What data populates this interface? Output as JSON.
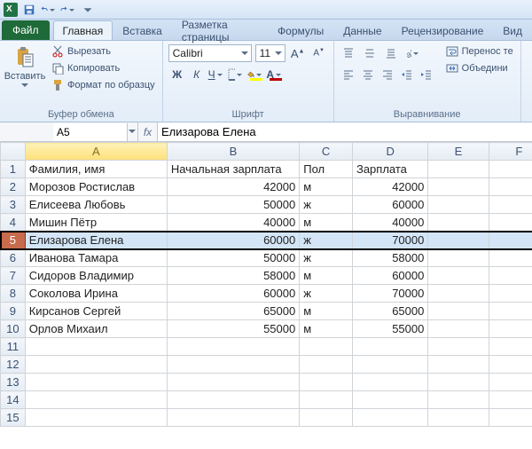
{
  "qat": {
    "save": "save-icon",
    "undo": "undo-icon",
    "redo": "redo-icon"
  },
  "tabs": {
    "file": "Файл",
    "items": [
      "Главная",
      "Вставка",
      "Разметка страницы",
      "Формулы",
      "Данные",
      "Рецензирование",
      "Вид"
    ],
    "active_index": 0
  },
  "ribbon": {
    "clipboard": {
      "paste": "Вставить",
      "cut": "Вырезать",
      "copy": "Копировать",
      "format_painter": "Формат по образцу",
      "group_label": "Буфер обмена"
    },
    "font": {
      "name": "Calibri",
      "size": "11",
      "bold": "Ж",
      "italic": "К",
      "underline": "Ч",
      "group_label": "Шрифт",
      "fill_color": "#ffff00",
      "font_color": "#c00000"
    },
    "alignment": {
      "wrap": "Перенос те",
      "merge": "Объедини",
      "group_label": "Выравнивание"
    }
  },
  "namebox": "A5",
  "fx_label": "fx",
  "formula": "Елизарова Елена",
  "columns": [
    "A",
    "B",
    "C",
    "D",
    "E",
    "F"
  ],
  "selected_row": 5,
  "selected_col": 0,
  "rows": [
    {
      "n": 1,
      "A": "Фамилия, имя",
      "B": "Начальная зарплата",
      "C": "Пол",
      "D": "Зарплата",
      "E": "",
      "F": ""
    },
    {
      "n": 2,
      "A": "Морозов Ростислав",
      "B": "42000",
      "C": "м",
      "D": "42000",
      "E": "",
      "F": ""
    },
    {
      "n": 3,
      "A": "Елисеева Любовь",
      "B": "50000",
      "C": "ж",
      "D": "60000",
      "E": "",
      "F": ""
    },
    {
      "n": 4,
      "A": "Мишин Пётр",
      "B": "40000",
      "C": "м",
      "D": "40000",
      "E": "",
      "F": ""
    },
    {
      "n": 5,
      "A": "Елизарова Елена",
      "B": "60000",
      "C": "ж",
      "D": "70000",
      "E": "",
      "F": ""
    },
    {
      "n": 6,
      "A": "Иванова Тамара",
      "B": "50000",
      "C": "ж",
      "D": "58000",
      "E": "",
      "F": ""
    },
    {
      "n": 7,
      "A": "Сидоров Владимир",
      "B": "58000",
      "C": "м",
      "D": "60000",
      "E": "",
      "F": ""
    },
    {
      "n": 8,
      "A": "Соколова Ирина",
      "B": "60000",
      "C": "ж",
      "D": "70000",
      "E": "",
      "F": ""
    },
    {
      "n": 9,
      "A": "Кирсанов Сергей",
      "B": "65000",
      "C": "м",
      "D": "65000",
      "E": "",
      "F": ""
    },
    {
      "n": 10,
      "A": "Орлов Михаил",
      "B": "55000",
      "C": "м",
      "D": "55000",
      "E": "",
      "F": ""
    },
    {
      "n": 11,
      "A": "",
      "B": "",
      "C": "",
      "D": "",
      "E": "",
      "F": ""
    },
    {
      "n": 12,
      "A": "",
      "B": "",
      "C": "",
      "D": "",
      "E": "",
      "F": ""
    },
    {
      "n": 13,
      "A": "",
      "B": "",
      "C": "",
      "D": "",
      "E": "",
      "F": ""
    },
    {
      "n": 14,
      "A": "",
      "B": "",
      "C": "",
      "D": "",
      "E": "",
      "F": ""
    },
    {
      "n": 15,
      "A": "",
      "B": "",
      "C": "",
      "D": "",
      "E": "",
      "F": ""
    }
  ]
}
